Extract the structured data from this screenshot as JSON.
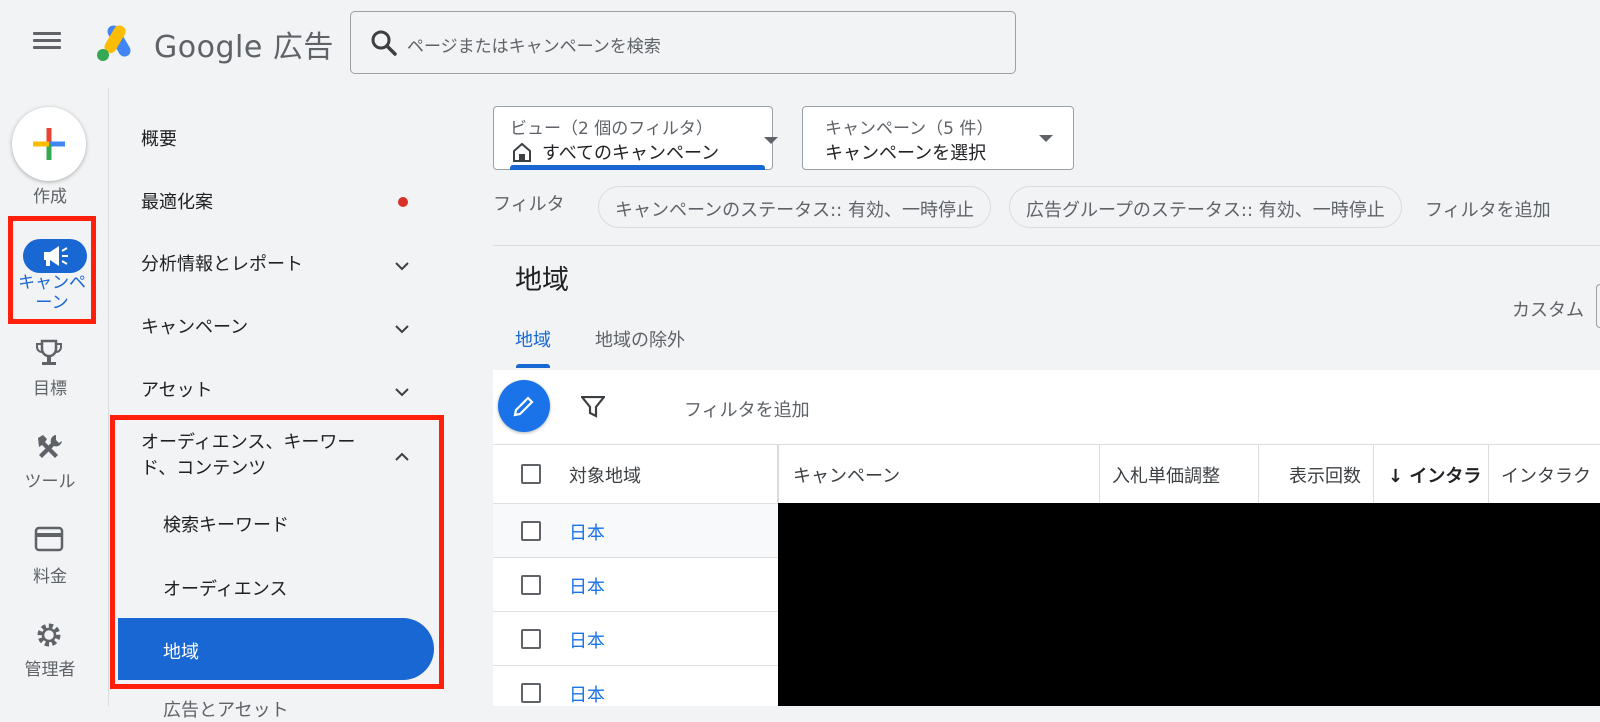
{
  "header": {
    "brand": "Google 広告",
    "search_placeholder": "ページまたはキャンペーンを検索"
  },
  "rail": {
    "create": "作成",
    "campaigns": "キャンペーン",
    "goals": "目標",
    "tools": "ツール",
    "billing": "料金",
    "admin": "管理者"
  },
  "nav": {
    "overview": "概要",
    "recommendations": "最適化案",
    "insights": "分析情報とレポート",
    "campaigns": "キャンペーン",
    "assets": "アセット",
    "audiences_line1": "オーディエンス、キーワー",
    "audiences_line2": "ド、コンテンツ",
    "search_keywords": "検索キーワード",
    "audiences": "オーディエンス",
    "locations": "地域",
    "cut_off": "広告とアセット"
  },
  "toolbar": {
    "view_caption": "ビュー（2 個のフィルタ）",
    "view_value": "すべてのキャンペーン",
    "campaign_caption": "キャンペーン（5 件）",
    "campaign_value": "キャンペーンを選択",
    "filter_label": "フィルタ",
    "chip1": "キャンペーンのステータス:: 有効、一時停止",
    "chip2": "広告グループのステータス:: 有効、一時停止",
    "add_filter": "フィルタを追加"
  },
  "page": {
    "title": "地域",
    "custom": "カスタム",
    "tab_locations": "地域",
    "tab_exclusions": "地域の除外"
  },
  "table": {
    "add_filter": "フィルタを追加",
    "headers": [
      "対象地域",
      "キャンペーン",
      "入札単価調整",
      "表示回数",
      "インタラ",
      "インタラク"
    ],
    "rows": [
      "日本",
      "日本",
      "日本",
      "日本"
    ]
  },
  "colors": {
    "accent": "#1967d2",
    "highlight_box": "#ff1f0a",
    "recommendation_dot": "#d93025"
  }
}
